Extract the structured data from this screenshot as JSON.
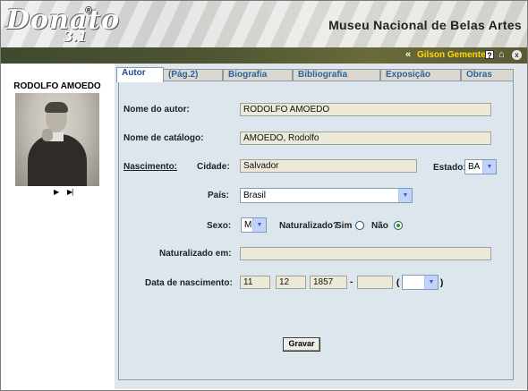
{
  "header": {
    "logo_text": "Donato",
    "logo_registered": "®",
    "logo_version": "3.1",
    "museum_name": "Museu Nacional de Belas Artes"
  },
  "userbar": {
    "back_symbol": "«",
    "user_name": "Gilson Gemente",
    "help_label": "?",
    "home_icon": "⌂",
    "close_label": "x"
  },
  "author_panel": {
    "name": "RODOLFO AMOEDO",
    "nav_next": "▶",
    "nav_last": "▶|"
  },
  "tabs": [
    {
      "label": "Autor",
      "active": true
    },
    {
      "label": "(Pág.2)",
      "active": false
    },
    {
      "label": "Biografia",
      "active": false
    },
    {
      "label": "Bibliografia",
      "active": false
    },
    {
      "label": "Exposição",
      "active": false
    },
    {
      "label": "Obras",
      "active": false
    }
  ],
  "form": {
    "nome_autor_label": "Nome do autor:",
    "nome_autor_value": "RODOLFO AMOEDO",
    "nome_catalogo_label": "Nome de catálogo:",
    "nome_catalogo_value": "AMOEDO, Rodolfo",
    "nascimento_label": "Nascimento:",
    "cidade_label": "Cidade:",
    "cidade_value": "Salvador",
    "estado_label": "Estado:",
    "estado_value": "BA",
    "pais_label": "País:",
    "pais_value": "Brasil",
    "sexo_label": "Sexo:",
    "sexo_value": "M",
    "naturalizado_label": "Naturalizado?",
    "sim_label": "Sim",
    "nao_label": "Não",
    "naturalizado_selected": "Não",
    "naturalizado_em_label": "Naturalizado em:",
    "naturalizado_em_value": "",
    "data_nascimento_label": "Data de nascimento:",
    "dia": "11",
    "mes": "12",
    "ano": "1857",
    "separator": "-",
    "ano_fim": "",
    "open_paren": "(",
    "close_paren": ")",
    "era_value": "",
    "save_label": "Gravar"
  },
  "colors": {
    "user_name": "#ffd800",
    "tab_text": "#2a64a0",
    "panel_bg": "#dde6ed"
  }
}
